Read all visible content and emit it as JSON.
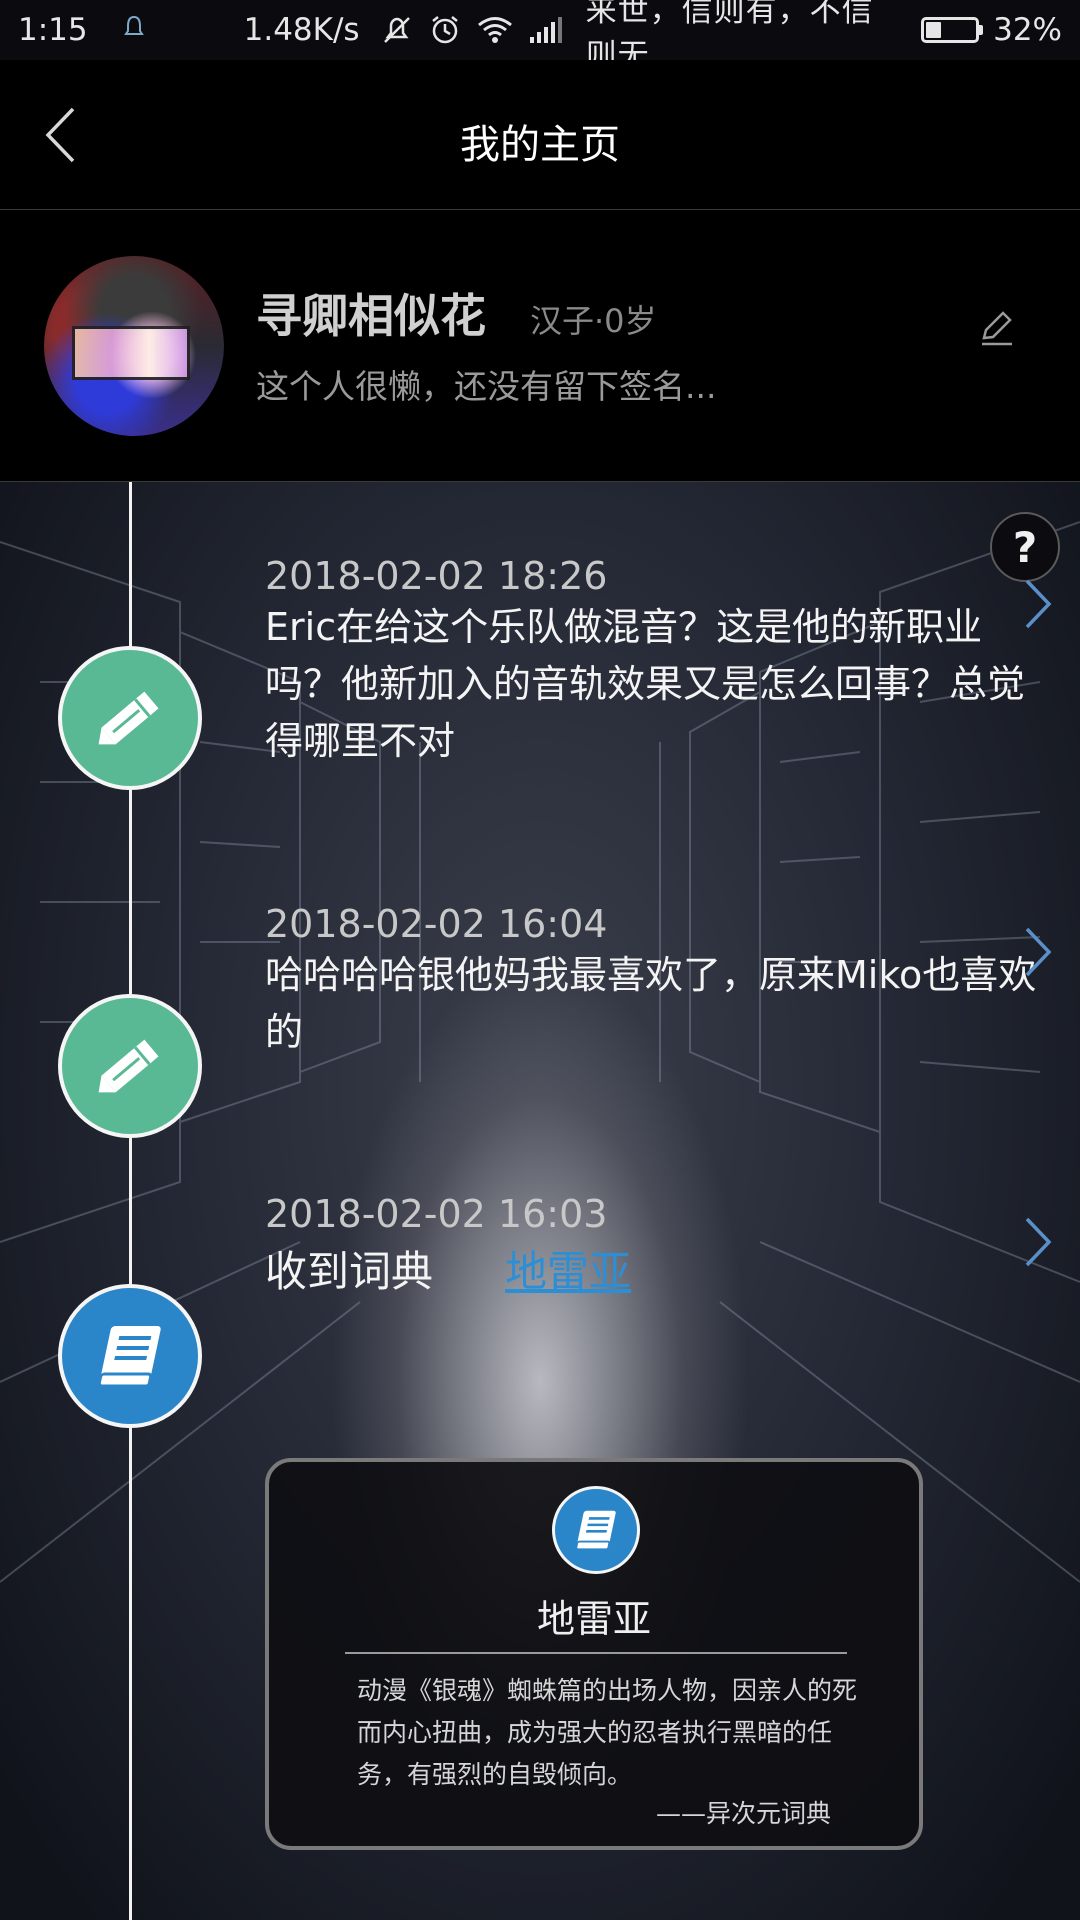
{
  "status_bar": {
    "time": "1:15",
    "network_speed": "1.48K/s",
    "carrier_text": "来世，信则有，不信则无",
    "battery_percent": "32%",
    "battery_level": 0.32,
    "icons": [
      "notification-icon",
      "mute-icon",
      "alarm-icon",
      "wifi-icon",
      "signal-icon",
      "battery-icon"
    ]
  },
  "header": {
    "title": "我的主页",
    "back_icon": "chevron-left-icon"
  },
  "profile": {
    "name": "寻卿相似花",
    "meta": "汉子·0岁",
    "signature": "这个人很懒，还没有留下签名...",
    "edit_icon": "pencil-icon"
  },
  "help_label": "?",
  "timeline": [
    {
      "icon": "pencil-icon",
      "color": "#58b994",
      "time": "2018-02-02 18:26",
      "text": "Eric在给这个乐队做混音？这是他的新职业吗？他新加入的音轨效果又是怎么回事？总觉得哪里不对"
    },
    {
      "icon": "pencil-icon",
      "color": "#58b994",
      "time": "2018-02-02 16:04",
      "text": "哈哈哈哈银他妈我最喜欢了，原来Miko也喜欢的"
    },
    {
      "icon": "book-icon",
      "color": "#2a86c8",
      "time": "2018-02-02 16:03",
      "label": "收到词典",
      "link": "地雷亚",
      "card": {
        "title": "地雷亚",
        "description": "动漫《银魂》蜘蛛篇的出场人物，因亲人的死而内心扭曲，成为强大的忍者执行黑暗的任务，有强烈的自毁倾向。",
        "source": "——异次元词典"
      }
    }
  ],
  "colors": {
    "link": "#2c8fd6",
    "green_node": "#58b994",
    "blue_node": "#2a86c8",
    "background": "#000000"
  }
}
